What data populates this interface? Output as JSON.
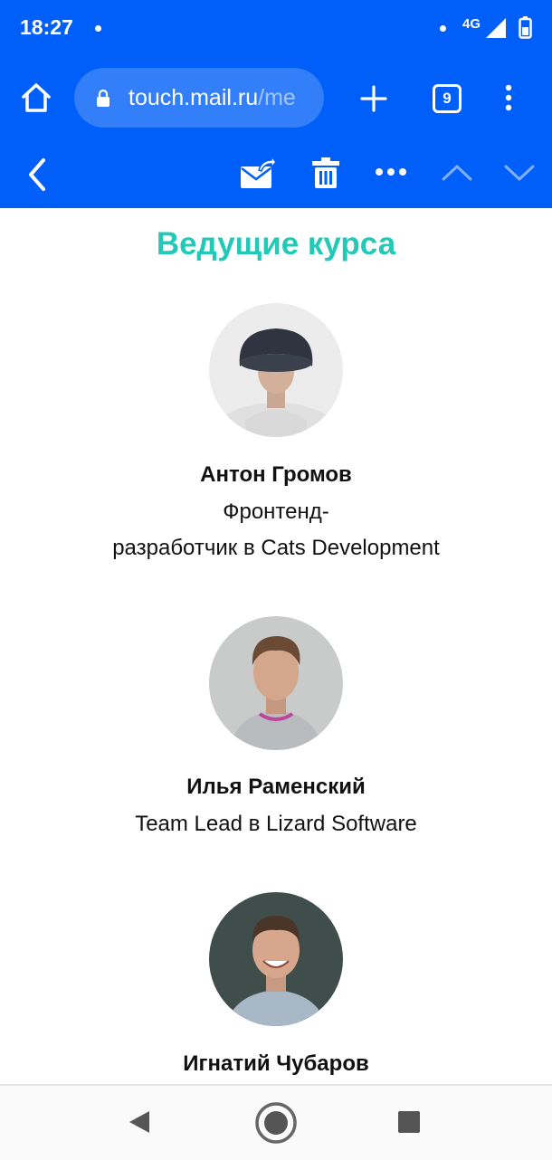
{
  "status_bar": {
    "time": "18:27",
    "network": "4G",
    "icons": [
      "notification-dot-icon",
      "signal-icon",
      "battery-icon"
    ]
  },
  "browser": {
    "url_host": "touch.mail.ru",
    "url_path": "/me",
    "tab_count": "9",
    "icons": [
      "home-icon",
      "lock-icon",
      "plus-icon",
      "tabs-icon",
      "kebab-menu-icon"
    ]
  },
  "mail_toolbar": {
    "icons": [
      "back-chevron-icon",
      "move-to-folder-icon",
      "trash-icon",
      "more-dots-icon",
      "previous-chevron-up-icon",
      "next-chevron-down-icon"
    ]
  },
  "content": {
    "section_title": "Ведущие курса",
    "speakers": [
      {
        "name": "Антон Громов",
        "role_line1": "Фронтенд-",
        "role_line2": "разработчик в Cats Development"
      },
      {
        "name": "Илья Раменский",
        "role_line1": "Team Lead в Lizard Software"
      },
      {
        "name": "Игнатий Чубаров"
      }
    ]
  },
  "nav_bar": {
    "icons": [
      "nav-back-icon",
      "nav-home-icon",
      "nav-recents-icon"
    ]
  },
  "colors": {
    "brand_blue": "#005ff9",
    "accent_teal": "#22c9b6"
  }
}
